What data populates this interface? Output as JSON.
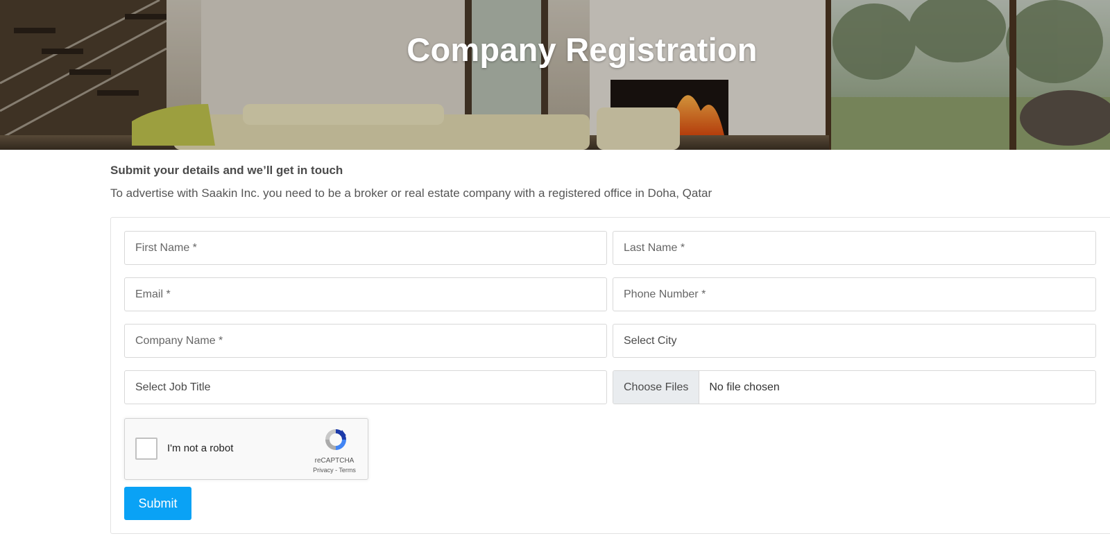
{
  "hero": {
    "title": "Company Registration"
  },
  "intro": {
    "heading": "Submit your details and we’ll get in touch",
    "text": "To advertise with Saakin Inc. you need to be a broker or real estate company with a registered office in Doha, Qatar"
  },
  "form": {
    "first_name_placeholder": "First Name *",
    "last_name_placeholder": "Last Name *",
    "email_placeholder": "Email *",
    "phone_placeholder": "Phone Number *",
    "company_placeholder": "Company Name *",
    "city_select": "Select City",
    "job_title_select": "Select Job Title",
    "file_button": "Choose Files",
    "file_status": "No file chosen",
    "submit_label": "Submit"
  },
  "recaptcha": {
    "label": "I'm not a robot",
    "brand": "reCAPTCHA",
    "links": "Privacy - Terms"
  },
  "colors": {
    "accent": "#0aa2f5",
    "border": "#d8d8d8"
  }
}
